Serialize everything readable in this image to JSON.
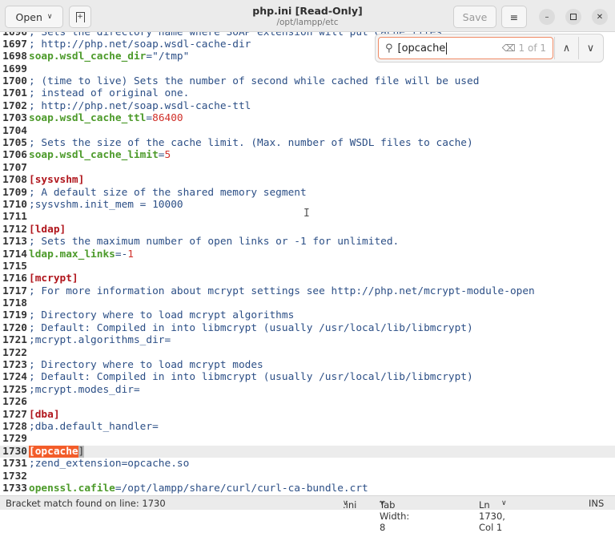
{
  "header": {
    "open_label": "Open",
    "title": "php.ini [Read-Only]",
    "subtitle": "/opt/lampp/etc",
    "save_label": "Save"
  },
  "search": {
    "value": "[opcache",
    "count": "1 of 1"
  },
  "editor": {
    "current_line": 1730,
    "lines": [
      {
        "n": "1696",
        "segs": [
          {
            "t": "; Sets the directory name where SOAP extension will put cache files.",
            "c": "comment"
          }
        ]
      },
      {
        "n": "1697",
        "segs": [
          {
            "t": "; http://php.net/soap.wsdl-cache-dir",
            "c": "comment"
          }
        ]
      },
      {
        "n": "1698",
        "segs": [
          {
            "t": "soap.wsdl_cache_dir",
            "c": "key"
          },
          {
            "t": "=",
            "c": "value"
          },
          {
            "t": "\"/tmp\"",
            "c": "value"
          }
        ]
      },
      {
        "n": "1699",
        "segs": []
      },
      {
        "n": "1700",
        "segs": [
          {
            "t": "; (time to live) Sets the number of second while cached file will be used",
            "c": "comment"
          }
        ]
      },
      {
        "n": "1701",
        "segs": [
          {
            "t": "; instead of original one.",
            "c": "comment"
          }
        ]
      },
      {
        "n": "1702",
        "segs": [
          {
            "t": "; http://php.net/soap.wsdl-cache-ttl",
            "c": "comment"
          }
        ]
      },
      {
        "n": "1703",
        "segs": [
          {
            "t": "soap.wsdl_cache_ttl",
            "c": "key"
          },
          {
            "t": "=",
            "c": "value"
          },
          {
            "t": "86400",
            "c": "num"
          }
        ]
      },
      {
        "n": "1704",
        "segs": []
      },
      {
        "n": "1705",
        "segs": [
          {
            "t": "; Sets the size of the cache limit. (Max. number of WSDL files to cache)",
            "c": "comment"
          }
        ]
      },
      {
        "n": "1706",
        "segs": [
          {
            "t": "soap.wsdl_cache_limit",
            "c": "key"
          },
          {
            "t": "=",
            "c": "value"
          },
          {
            "t": "5",
            "c": "num"
          }
        ]
      },
      {
        "n": "1707",
        "segs": []
      },
      {
        "n": "1708",
        "segs": [
          {
            "t": "[sysvshm]",
            "c": "section"
          }
        ]
      },
      {
        "n": "1709",
        "segs": [
          {
            "t": "; A default size of the shared memory segment",
            "c": "comment"
          }
        ]
      },
      {
        "n": "1710",
        "segs": [
          {
            "t": ";sysvshm.init_mem = 10000",
            "c": "comment"
          }
        ]
      },
      {
        "n": "1711",
        "segs": []
      },
      {
        "n": "1712",
        "segs": [
          {
            "t": "[ldap]",
            "c": "section"
          }
        ]
      },
      {
        "n": "1713",
        "segs": [
          {
            "t": "; Sets the maximum number of open links or -1 for unlimited.",
            "c": "comment"
          }
        ]
      },
      {
        "n": "1714",
        "segs": [
          {
            "t": "ldap.max_links",
            "c": "key"
          },
          {
            "t": "=-",
            "c": "value"
          },
          {
            "t": "1",
            "c": "num"
          }
        ]
      },
      {
        "n": "1715",
        "segs": []
      },
      {
        "n": "1716",
        "segs": [
          {
            "t": "[mcrypt]",
            "c": "section"
          }
        ]
      },
      {
        "n": "1717",
        "segs": [
          {
            "t": "; For more information about mcrypt settings see http://php.net/mcrypt-module-open",
            "c": "comment"
          }
        ]
      },
      {
        "n": "1718",
        "segs": []
      },
      {
        "n": "1719",
        "segs": [
          {
            "t": "; Directory where to load mcrypt algorithms",
            "c": "comment"
          }
        ]
      },
      {
        "n": "1720",
        "segs": [
          {
            "t": "; Default: Compiled in into libmcrypt (usually /usr/local/lib/libmcrypt)",
            "c": "comment"
          }
        ]
      },
      {
        "n": "1721",
        "segs": [
          {
            "t": ";mcrypt.algorithms_dir=",
            "c": "comment"
          }
        ]
      },
      {
        "n": "1722",
        "segs": []
      },
      {
        "n": "1723",
        "segs": [
          {
            "t": "; Directory where to load mcrypt modes",
            "c": "comment"
          }
        ]
      },
      {
        "n": "1724",
        "segs": [
          {
            "t": "; Default: Compiled in into libmcrypt (usually /usr/local/lib/libmcrypt)",
            "c": "comment"
          }
        ]
      },
      {
        "n": "1725",
        "segs": [
          {
            "t": ";mcrypt.modes_dir=",
            "c": "comment"
          }
        ]
      },
      {
        "n": "1726",
        "segs": []
      },
      {
        "n": "1727",
        "segs": [
          {
            "t": "[dba]",
            "c": "section"
          }
        ]
      },
      {
        "n": "1728",
        "segs": [
          {
            "t": ";dba.default_handler=",
            "c": "comment"
          }
        ]
      },
      {
        "n": "1729",
        "segs": []
      },
      {
        "n": "1730",
        "segs": [
          {
            "t": "[opcache",
            "c": "match"
          },
          {
            "t": "]",
            "c": "bracket"
          }
        ]
      },
      {
        "n": "1731",
        "segs": [
          {
            "t": ";zend_extension=opcache.so",
            "c": "comment"
          }
        ]
      },
      {
        "n": "1732",
        "segs": []
      },
      {
        "n": "1733",
        "segs": [
          {
            "t": "openssl.cafile",
            "c": "key"
          },
          {
            "t": "=/opt/lampp/share/curl/curl-ca-bundle.crt",
            "c": "value"
          }
        ]
      }
    ]
  },
  "statusbar": {
    "message": "Bracket match found on line: 1730",
    "language": ".ini",
    "tab_width": "Tab Width: 8",
    "position": "Ln 1730, Col 1",
    "mode": "INS"
  }
}
